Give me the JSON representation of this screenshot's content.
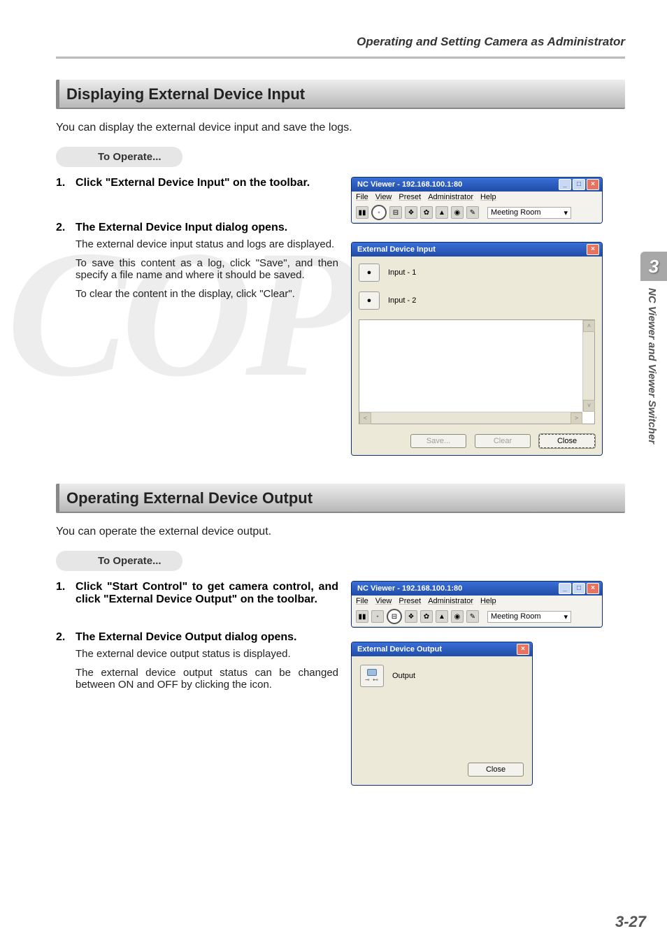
{
  "header": {
    "running_head": "Operating and Setting Camera as Administrator"
  },
  "side_tab": {
    "number": "3",
    "label": "NC Viewer and Viewer Switcher"
  },
  "page_number": "3-27",
  "watermark": "COPY",
  "section1": {
    "heading": "Displaying External Device Input",
    "intro": "You can display the external device input and save the logs.",
    "operate_label": "To Operate...",
    "step1_title": "Click \"External Device Input\" on the toolbar.",
    "step2_title": "The External Device Input dialog opens.",
    "step2_body1": "The external device input status and logs are displayed.",
    "step2_body2": "To save this content as a log, click \"Save\", and then specify a file name and where it should be saved.",
    "step2_body3": "To clear the content in the display, click \"Clear\"."
  },
  "nc_viewer": {
    "title": "NC Viewer - 192.168.100.1:80",
    "menu": {
      "file": "File",
      "view": "View",
      "preset": "Preset",
      "admin": "Administrator",
      "help": "Help"
    },
    "preset_selected": "Meeting Room"
  },
  "input_dialog": {
    "title": "External Device Input",
    "input1": "Input - 1",
    "input2": "Input - 2",
    "save": "Save...",
    "clear": "Clear",
    "close": "Close"
  },
  "section2": {
    "heading": "Operating External Device Output",
    "intro": "You can operate the external device output.",
    "operate_label": "To Operate...",
    "step1_title": "Click \"Start Control\" to get camera control, and click \"External Device Output\" on the toolbar.",
    "step2_title": "The External Device Output dialog opens.",
    "step2_body1": "The external device output status is displayed.",
    "step2_body2": "The external device output status can be changed between ON and OFF by clicking the icon."
  },
  "output_dialog": {
    "title": "External Device Output",
    "output_label": "Output",
    "close": "Close"
  }
}
